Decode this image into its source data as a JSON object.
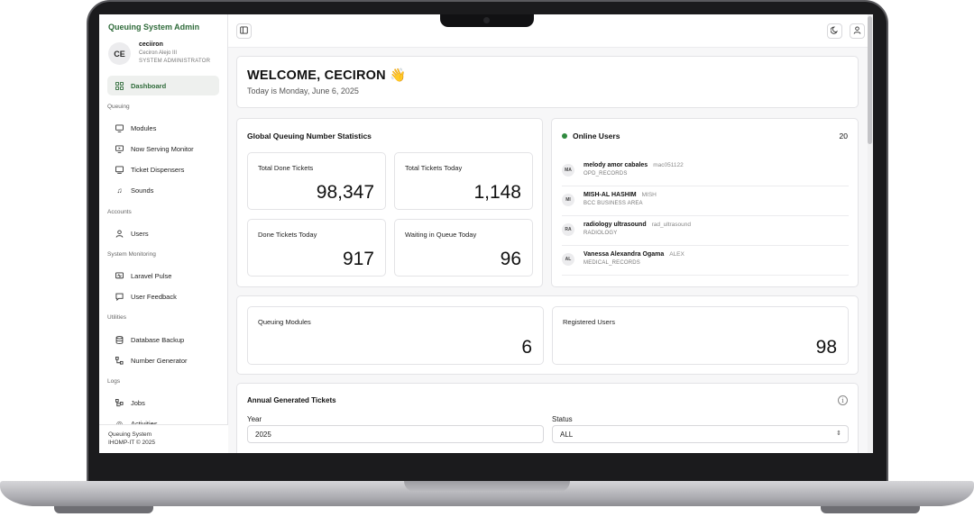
{
  "sidebar": {
    "brand": "Queuing System Admin",
    "user": {
      "initials": "CE",
      "username": "ceciiron",
      "full_name": "Ceciron Alejo III",
      "role": "SYSTEM ADMINISTRATOR"
    },
    "items": [
      {
        "label": "Dashboard",
        "icon": "grid-icon"
      },
      {
        "label": "Modules",
        "icon": "monitor-settings-icon"
      },
      {
        "label": "Now Serving Monitor",
        "icon": "monitor-play-icon"
      },
      {
        "label": "Ticket Dispensers",
        "icon": "screen-icon"
      },
      {
        "label": "Sounds",
        "icon": "music-icon"
      },
      {
        "label": "Users",
        "icon": "user-icon"
      },
      {
        "label": "Laravel Pulse",
        "icon": "pulse-monitor-icon"
      },
      {
        "label": "User Feedback",
        "icon": "message-icon"
      },
      {
        "label": "Database Backup",
        "icon": "database-icon"
      },
      {
        "label": "Number Generator",
        "icon": "hierarchy-icon"
      },
      {
        "label": "Jobs",
        "icon": "jobs-icon"
      },
      {
        "label": "Activities",
        "icon": "activity-icon"
      }
    ],
    "sections": [
      "Queuing",
      "Accounts",
      "System Monitoring",
      "Utilities",
      "Logs"
    ],
    "footer": {
      "line1": "Queuing System",
      "line2": "IHOMP-IT © 2025"
    }
  },
  "topbar": {
    "toggle_icon": "sidebar-toggle-icon",
    "theme_icon": "moon-icon",
    "profile_icon": "user-icon"
  },
  "welcome": {
    "title": "WELCOME, CECIRON 👋",
    "subtitle": "Today is Monday, June 6, 2025"
  },
  "stats": {
    "title": "Global Queuing Number Statistics",
    "cards": [
      {
        "label": "Total Done Tickets",
        "value": "98,347"
      },
      {
        "label": "Total Tickets Today",
        "value": "1,148"
      },
      {
        "label": "Done Tickets Today",
        "value": "917"
      },
      {
        "label": "Waiting in Queue Today",
        "value": "96"
      }
    ]
  },
  "online_users": {
    "title": "Online Users",
    "count": "20",
    "users": [
      {
        "initials": "MA",
        "name": "melody amor cabales",
        "handle": "mac051122",
        "dept": "OPD_RECORDS"
      },
      {
        "initials": "MI",
        "name": "MISH-AL HASHIM",
        "handle": "MISH",
        "dept": "BCC BUSINESS AREA"
      },
      {
        "initials": "RA",
        "name": "radiology ultrasound",
        "handle": "rad_ultrasound",
        "dept": "RADIOLOGY"
      },
      {
        "initials": "AL",
        "name": "Vanessa Alexandra Ogama",
        "handle": "ALEX",
        "dept": "MEDICAL_RECORDS"
      }
    ]
  },
  "totals": [
    {
      "label": "Queuing Modules",
      "value": "6"
    },
    {
      "label": "Registered Users",
      "value": "98"
    }
  ],
  "annual": {
    "title": "Annual Generated Tickets",
    "year_label": "Year",
    "year_value": "2025",
    "status_label": "Status",
    "status_value": "ALL"
  }
}
